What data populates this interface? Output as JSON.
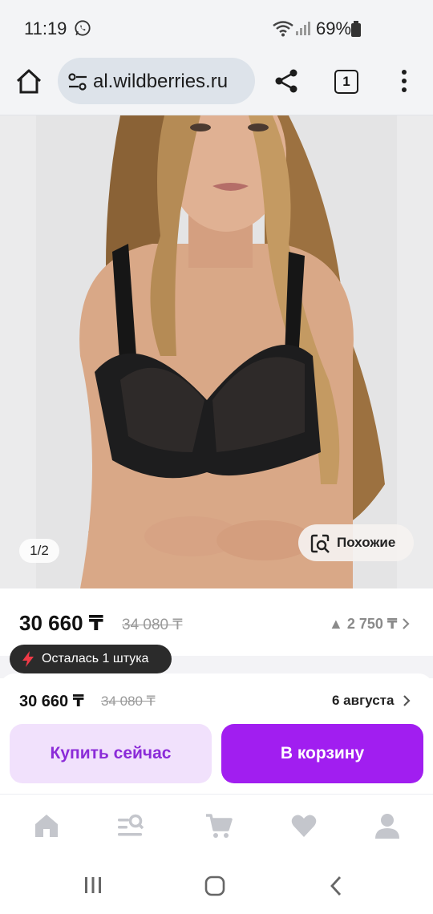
{
  "status_bar": {
    "time": "11:19",
    "battery": "69%"
  },
  "browser": {
    "url": "al.wildberries.ru",
    "tab_count": "1"
  },
  "product": {
    "image_counter": "1/2",
    "similar_label": "Похожие",
    "price": "30 660 ₸",
    "old_price": "34 080 ₸",
    "price_delta": "▲ 2 750 ₸",
    "stock_note": "Осталась 1 штука"
  },
  "purchase": {
    "price": "30 660 ₸",
    "old_price": "34 080 ₸",
    "delivery_date": "6 августа",
    "buy_now_label": "Купить сейчас",
    "add_to_cart_label": "В корзину"
  },
  "colors": {
    "accent": "#a11ef0",
    "accent_light": "#f1e1fc",
    "accent_text": "#8b2bd8",
    "icon_gray": "#c4c6cc"
  },
  "bottom_nav": {
    "items": [
      "home-icon",
      "catalog-search-icon",
      "cart-icon",
      "heart-icon",
      "profile-icon"
    ]
  }
}
